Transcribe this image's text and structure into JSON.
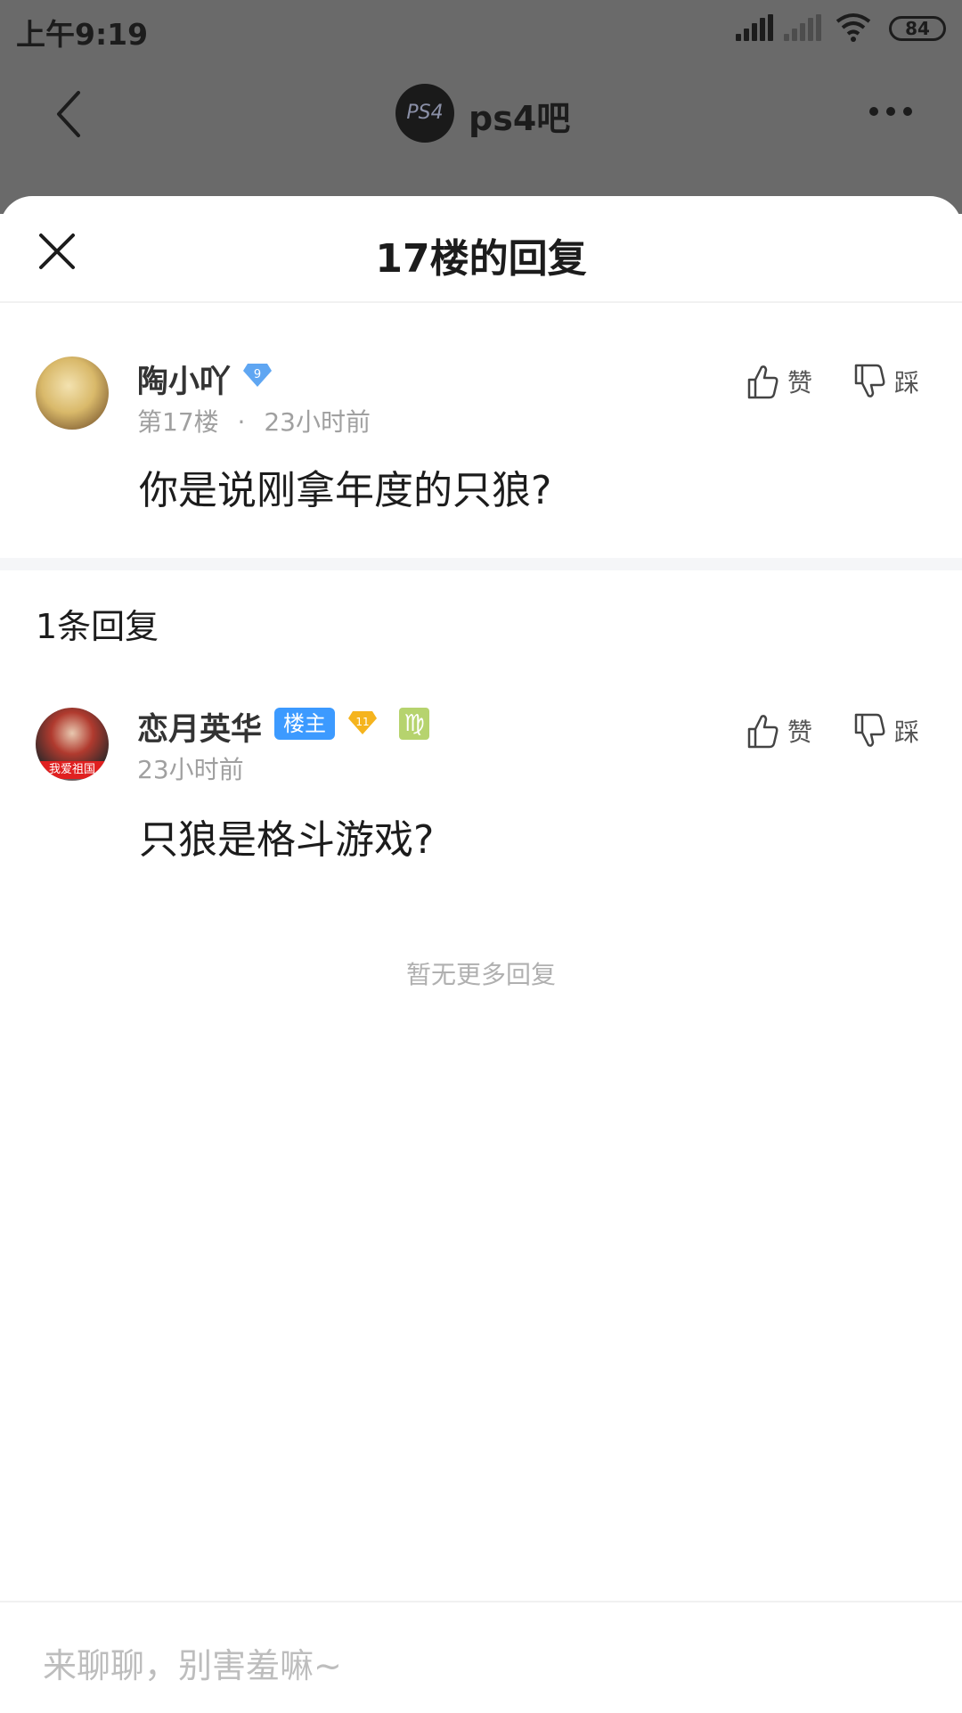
{
  "status_bar": {
    "time": "上午9:19",
    "battery": "84"
  },
  "nav": {
    "forum_name": "ps4吧",
    "forum_logo_text": "PS4"
  },
  "sheet": {
    "title": "17楼的回复"
  },
  "main_comment": {
    "username": "陶小吖",
    "level": "9",
    "floor": "第17楼",
    "separator": "·",
    "time": "23小时前",
    "text": "你是说刚拿年度的只狼?",
    "like_label": "赞",
    "dislike_label": "踩"
  },
  "replies_section": {
    "count_label": "1条回复"
  },
  "reply": {
    "username": "恋月英华",
    "owner_tag": "楼主",
    "level": "11",
    "zodiac": "♍",
    "time": "23小时前",
    "text": "只狼是格斗游戏?",
    "like_label": "赞",
    "dislike_label": "踩",
    "avatar_text": "我爱祖国"
  },
  "no_more_label": "暂无更多回复",
  "input": {
    "placeholder": "来聊聊，别害羞嘛~"
  },
  "colors": {
    "accent": "#3c9aff",
    "dim_overlay": "#6a6a6a",
    "level_blue": "#5fa6f2",
    "level_gold": "#f5b41e"
  }
}
